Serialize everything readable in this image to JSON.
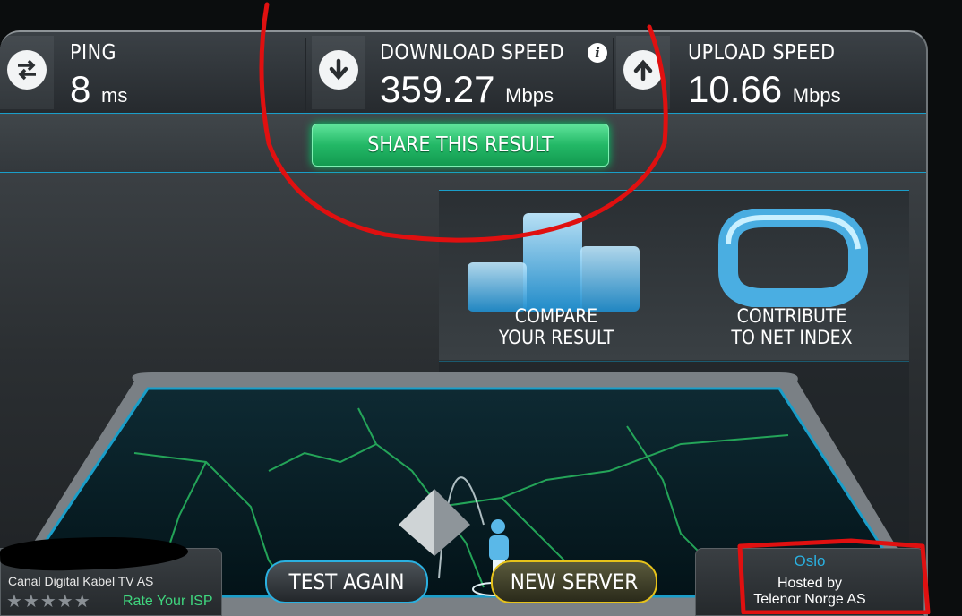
{
  "metrics": {
    "ping": {
      "title": "PING",
      "value": "8",
      "unit": "ms",
      "icon": "swap-arrows-icon"
    },
    "download": {
      "title": "DOWNLOAD SPEED",
      "value": "359.27",
      "unit": "Mbps",
      "icon": "arrow-down-icon",
      "info": "i"
    },
    "upload": {
      "title": "UPLOAD SPEED",
      "value": "10.66",
      "unit": "Mbps",
      "icon": "arrow-up-icon"
    }
  },
  "share_button": "SHARE THIS RESULT",
  "panels": {
    "compare": {
      "line1": "COMPARE",
      "line2": "YOUR RESULT"
    },
    "contribute": {
      "line1": "CONTRIBUTE",
      "line2": "TO NET INDEX"
    }
  },
  "buttons": {
    "test_again": "TEST AGAIN",
    "new_server": "NEW SERVER"
  },
  "isp": {
    "name": "Canal Digital Kabel TV AS",
    "stars": "★★★★★",
    "rate_label": "Rate Your ISP"
  },
  "host": {
    "city": "Oslo",
    "hosted_by": "Hosted by",
    "provider": "Telenor Norge AS"
  },
  "colors": {
    "accent": "#1a9ec9",
    "share_green": "#23b866",
    "new_server_gold": "#e6c21a",
    "annotation_red": "#e01010"
  }
}
